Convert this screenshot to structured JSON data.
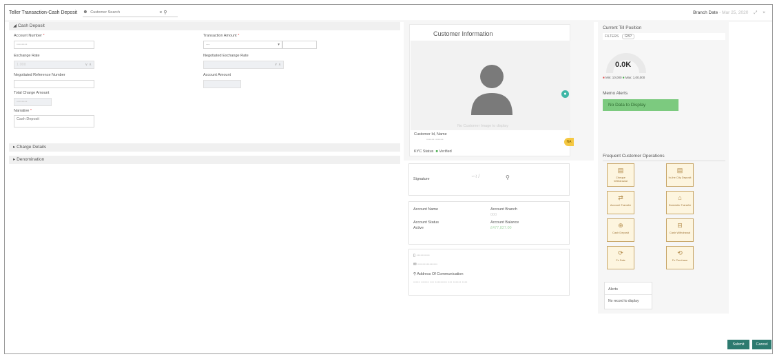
{
  "header": {
    "title": "Teller Transaction-Cash Deposit",
    "search_placeholder": "Customer Search",
    "search_clear": "×",
    "search_icon": "⚲",
    "branch_label": "Branch Date",
    "branch_value": "- Mar 25, 2020",
    "expand_icon": "⤢",
    "close_icon": "×"
  },
  "cash_deposit": {
    "section": "Cash Deposit",
    "account_number_label": "Account Number",
    "account_number_value": "••••••••",
    "transaction_amount_label": "Transaction Amount",
    "currency_value": "---",
    "exchange_rate_label": "Exchange Rate",
    "exchange_rate_value": "1.000",
    "negotiated_exchange_rate_label": "Negotiated Exchange Rate",
    "negotiated_reference_label": "Negotiated Reference Number",
    "account_amount_label": "Account Amount",
    "total_charge_label": "Total Charge Amount",
    "total_charge_value": "••••••••",
    "narrative_label": "Narrative",
    "narrative_value": "Cash Deposit"
  },
  "collapsed_sections": [
    "Charge Details",
    "Denomination"
  ],
  "customer_info": {
    "title": "Customer Information",
    "no_image": "No Customer Image to display",
    "customer_id_label": "Customer Id, Name",
    "customer_id_value": "•••••• ••••••",
    "badge": "NA",
    "kyc_label": "KYC Status",
    "kyc_value": "Verified"
  },
  "signature": {
    "label": "Signature"
  },
  "account": {
    "name_label": "Account Name",
    "branch_label": "Account Branch",
    "branch_value": "000",
    "status_label": "Account Status",
    "status_value": "Active",
    "balance_label": "Account Balance",
    "balance_value": "£477,827.00"
  },
  "contact": {
    "phone": "••••••••••",
    "email": "•••••••••••••••",
    "address_label": "Address Of Communication",
    "address_value": "••••• •••••• ••• ••••••••• ••• •••••• ••••"
  },
  "till": {
    "title": "Current Till Position",
    "filters_label": "FILTERS",
    "filter_value": "GBP",
    "gauge_value": "0.0K",
    "gauge_fraction": 0,
    "min_label": "Min: 10,000",
    "max_label": "Max: 1,00,000"
  },
  "memo": {
    "title": "Memo Alerts",
    "empty": "No Data to Display"
  },
  "frequent_ops": {
    "title": "Frequent Customer Operations",
    "items": [
      {
        "label": "Cheque Withdrawal",
        "icon": "▤"
      },
      {
        "label": "In-the City Deposit",
        "icon": "▤"
      },
      {
        "label": "Account Transfer",
        "icon": "⇄"
      },
      {
        "label": "Domestic Transfer",
        "icon": "⌂"
      },
      {
        "label": "Cash Deposit",
        "icon": "⊕"
      },
      {
        "label": "Cash Withdrawal",
        "icon": "⊟"
      },
      {
        "label": "Fx Sale",
        "icon": "⟳"
      },
      {
        "label": "Fx Purchase",
        "icon": "⟲"
      }
    ]
  },
  "alerts": {
    "title": "Alerts",
    "empty": "No record to display"
  },
  "footer": {
    "submit": "Submit",
    "cancel": "Cancel"
  },
  "colors": {
    "accent": "#2d7a6f",
    "memo_green": "#7cca7f",
    "op_border": "#c9a86a",
    "gauge": "#e9e9e9"
  }
}
